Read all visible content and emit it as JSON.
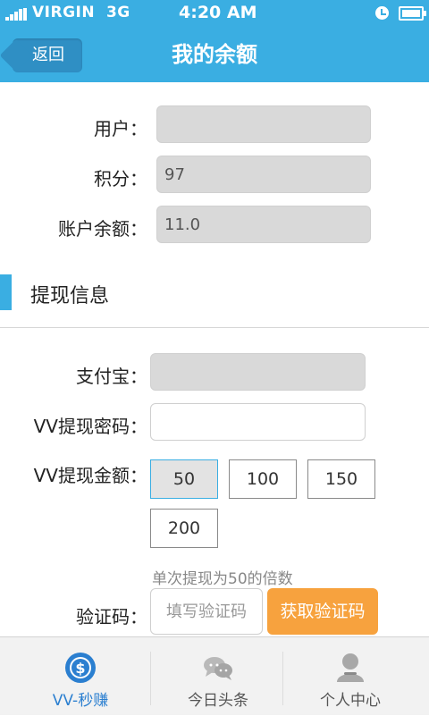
{
  "status_bar": {
    "carrier": "VIRGIN",
    "network": "3G",
    "time": "4:20 AM"
  },
  "header": {
    "back_label": "返回",
    "title": "我的余额"
  },
  "account": {
    "user_label": "用户：",
    "user_value": "",
    "points_label": "积分：",
    "points_value": "97",
    "balance_label": "账户余额：",
    "balance_value": "11.0"
  },
  "withdraw": {
    "section_title": "提现信息",
    "alipay_label": "支付宝：",
    "alipay_value": "",
    "password_label": "VV提现密码：",
    "password_value": "",
    "amount_label": "VV提现金额：",
    "amounts": [
      "50",
      "100",
      "150",
      "200"
    ],
    "selected_amount": "50",
    "hint": "单次提现为50的倍数",
    "code_label": "验证码：",
    "code_placeholder": "填写验证码",
    "get_code_button": "获取验证码"
  },
  "bottom_nav": {
    "items": [
      {
        "label": "VV-秒赚",
        "icon": "vv-coin-icon",
        "active": true
      },
      {
        "label": "今日头条",
        "icon": "chat-bubbles-icon",
        "active": false
      },
      {
        "label": "个人中心",
        "icon": "person-icon",
        "active": false
      }
    ]
  },
  "colors": {
    "primary": "#3aaee2",
    "accent_orange": "#f7a23e",
    "active_nav": "#2b7fd0"
  }
}
